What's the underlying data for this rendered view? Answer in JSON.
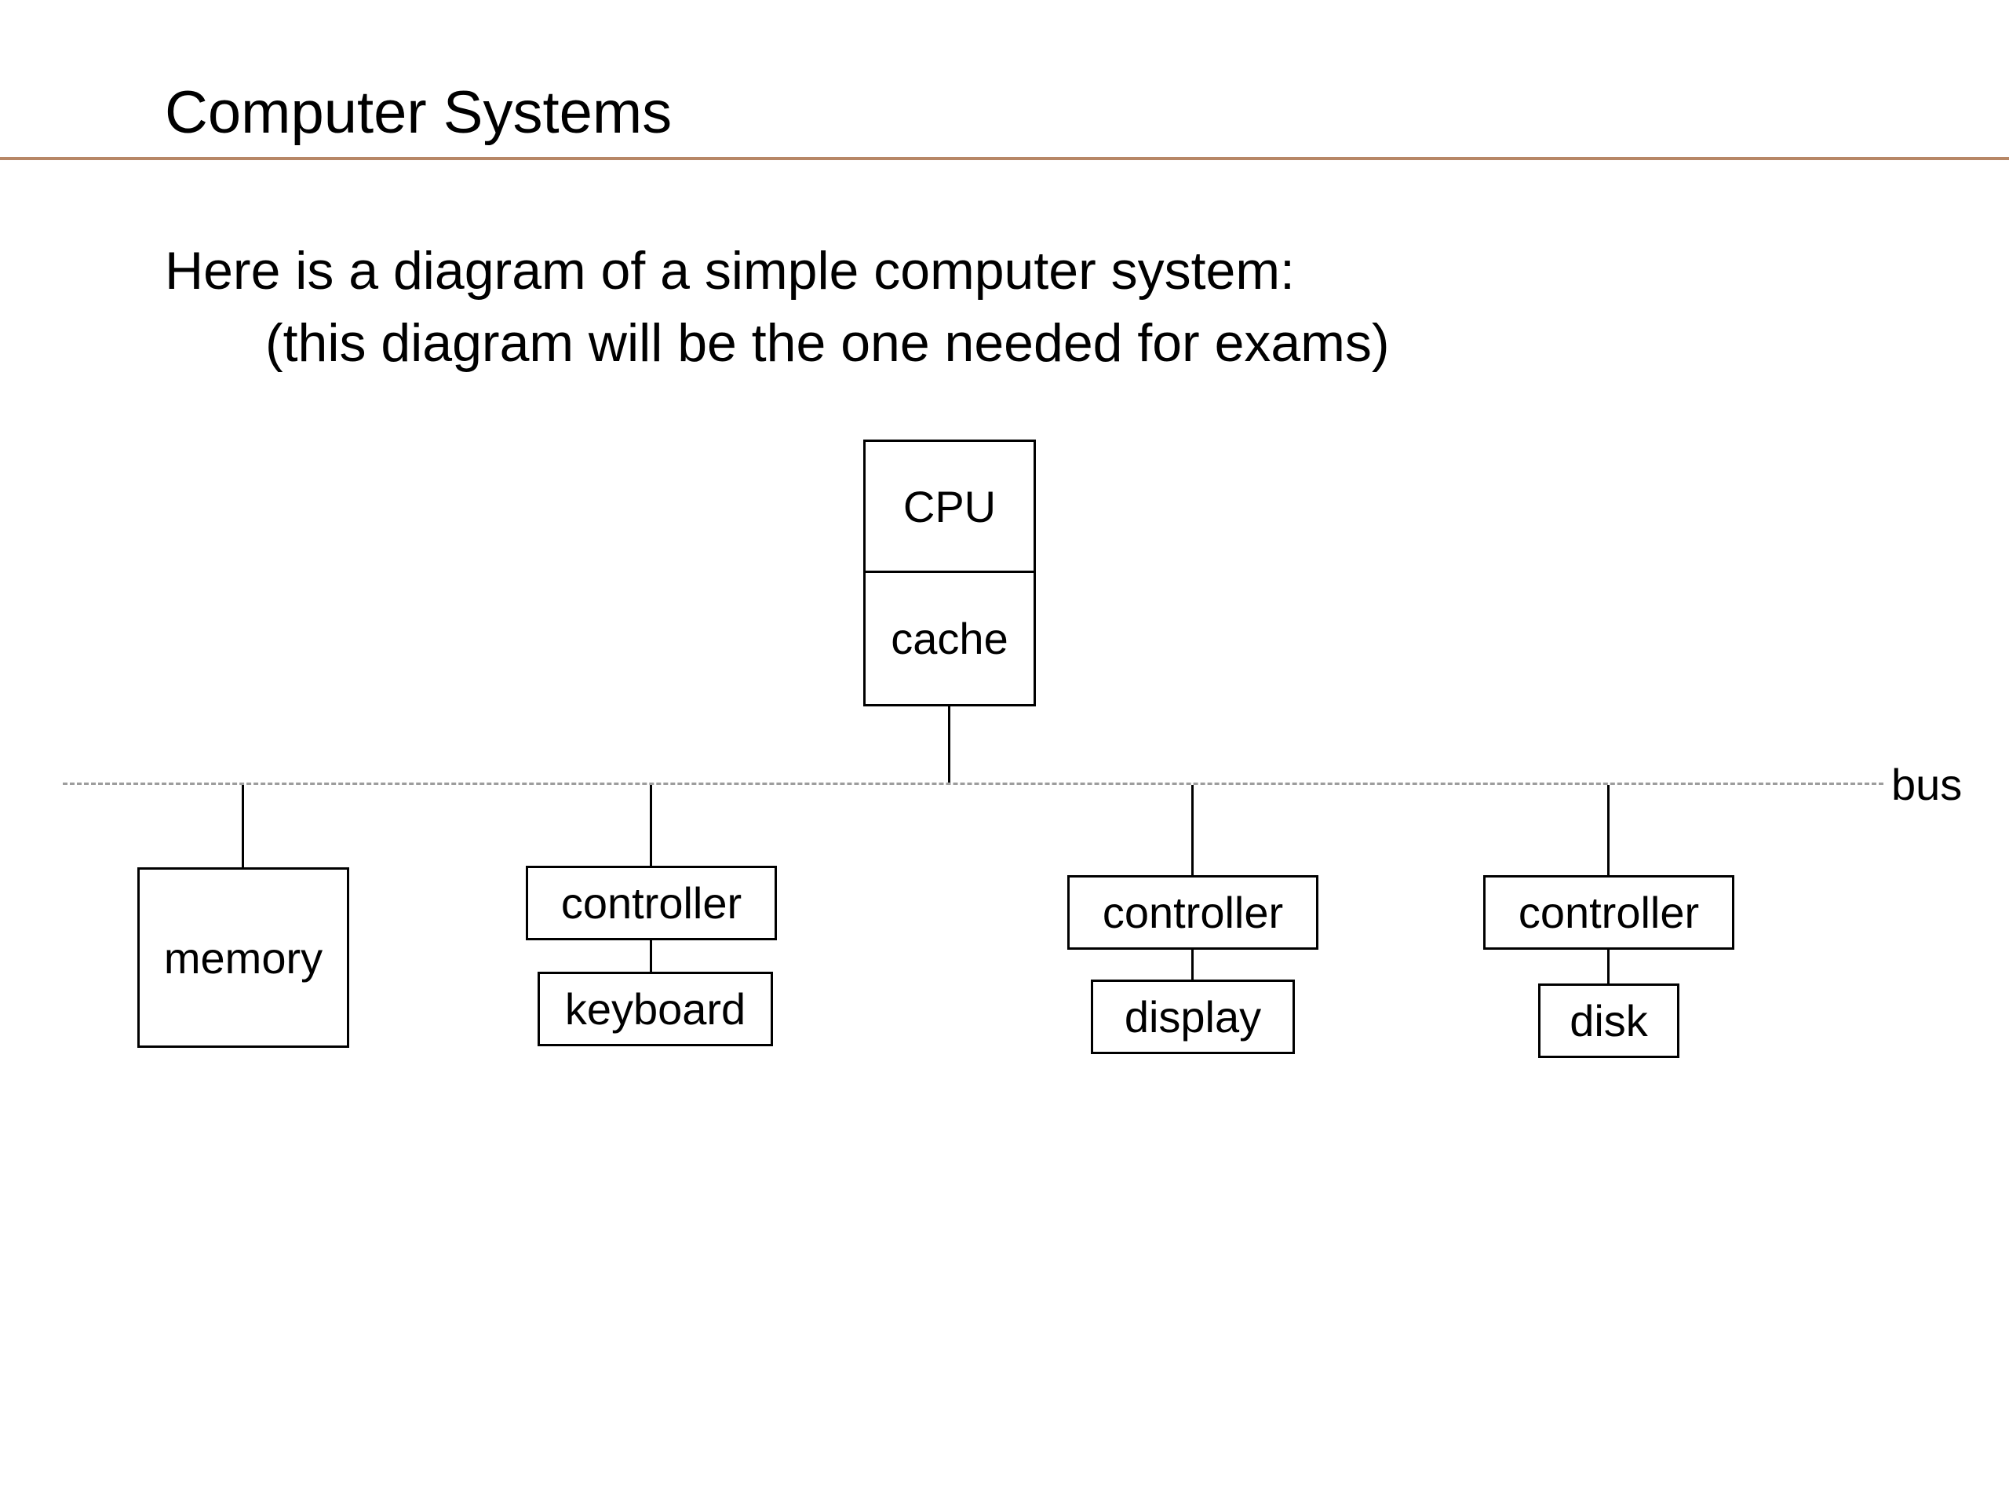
{
  "title": "Computer Systems",
  "intro_line1": "Here is a diagram of a simple computer system:",
  "intro_line2": "(this diagram will be the one needed for exams)",
  "diagram": {
    "cpu": "CPU",
    "cache": "cache",
    "bus": "bus",
    "memory": "memory",
    "controller1": "controller",
    "keyboard": "keyboard",
    "controller2": "controller",
    "display": "display",
    "controller3": "controller",
    "disk": "disk"
  }
}
